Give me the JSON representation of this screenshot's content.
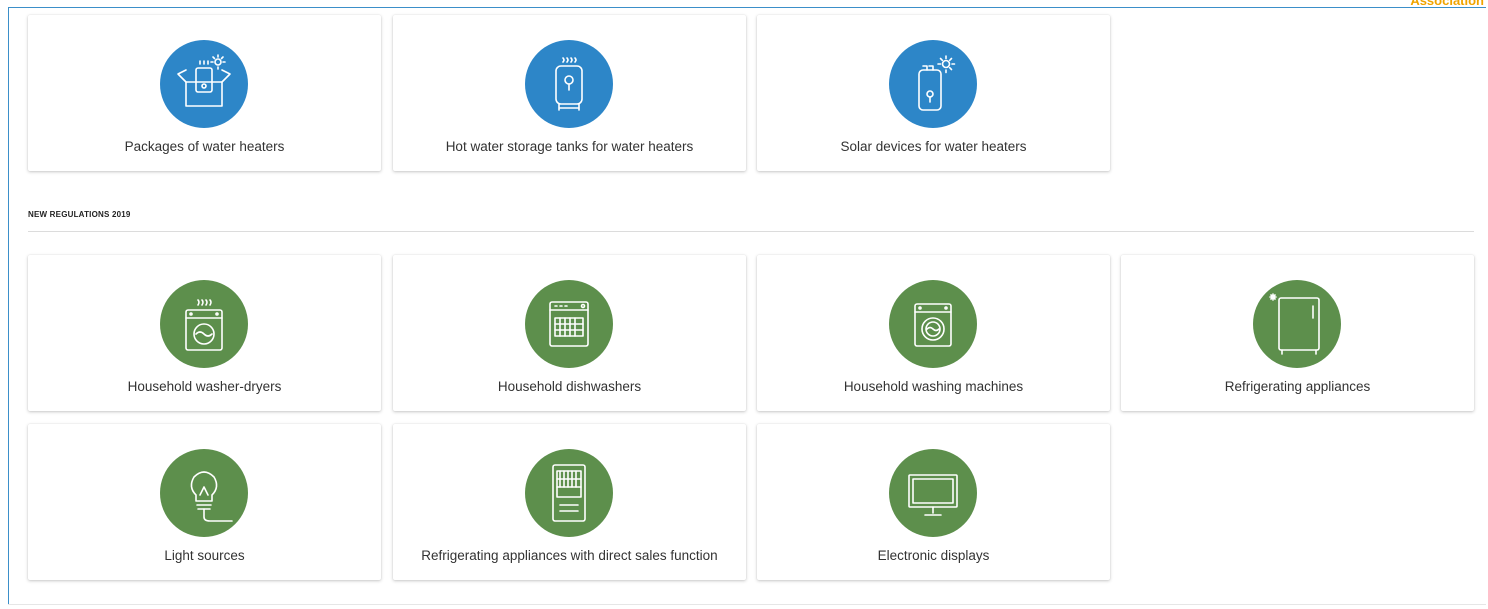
{
  "brand": {
    "text": "Association"
  },
  "top_cards": [
    {
      "label": "Packages of water heaters",
      "icon": "water-heater-package-icon",
      "color": "#2d86c8"
    },
    {
      "label": "Hot water storage tanks for water heaters",
      "icon": "hot-water-tank-icon",
      "color": "#2d86c8"
    },
    {
      "label": "Solar devices for water heaters",
      "icon": "solar-water-heater-icon",
      "color": "#2d86c8"
    }
  ],
  "section": {
    "title": "NEW REGULATIONS 2019",
    "cards": [
      {
        "label": "Household washer-dryers",
        "icon": "washer-dryer-icon",
        "color": "#5d8f4c"
      },
      {
        "label": "Household dishwashers",
        "icon": "dishwasher-icon",
        "color": "#5d8f4c"
      },
      {
        "label": "Household washing machines",
        "icon": "washing-machine-icon",
        "color": "#5d8f4c"
      },
      {
        "label": "Refrigerating appliances",
        "icon": "refrigerator-icon",
        "color": "#5d8f4c"
      },
      {
        "label": "Light sources",
        "icon": "light-bulb-icon",
        "color": "#5d8f4c"
      },
      {
        "label": "Refrigerating appliances with direct sales function",
        "icon": "display-cabinet-icon",
        "color": "#5d8f4c"
      },
      {
        "label": "Electronic displays",
        "icon": "monitor-icon",
        "color": "#5d8f4c"
      }
    ]
  }
}
